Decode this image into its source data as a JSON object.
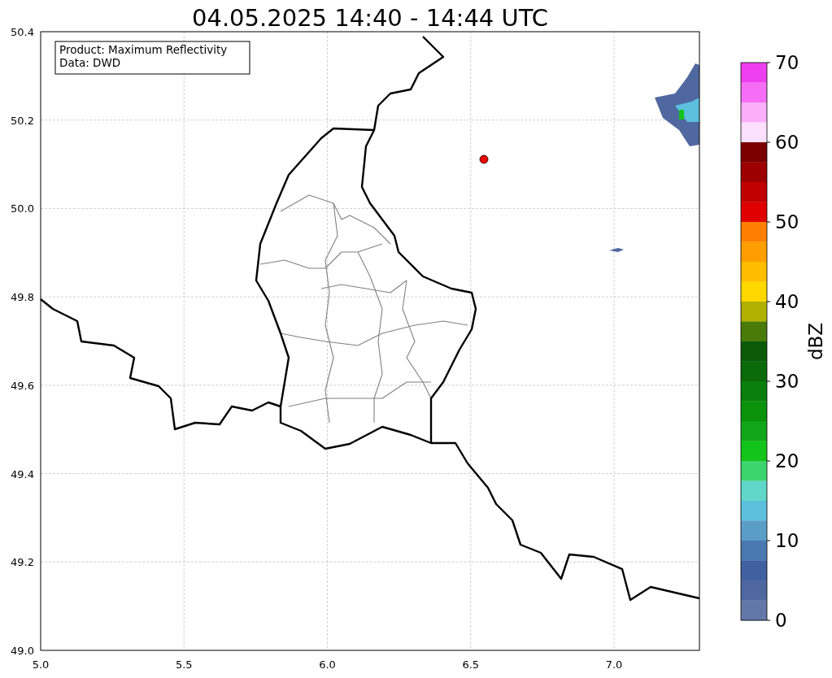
{
  "title": "04.05.2025 14:40 - 14:44 UTC",
  "info_box": [
    "Product: Maximum Reflectivity",
    "Data: DWD"
  ],
  "y_ticks": [
    "50.4",
    "50.2",
    "50.0",
    "49.8",
    "49.6",
    "49.4",
    "49.2",
    "49.0"
  ],
  "x_ticks": [
    "5.0",
    "5.5",
    "6.0",
    "6.5",
    "7.0"
  ],
  "colorbar": {
    "label": "dBZ",
    "ticks": [
      "70",
      "60",
      "50",
      "40",
      "30",
      "20",
      "10",
      "0"
    ],
    "segments": [
      {
        "color": "#ee3fee"
      },
      {
        "color": "#f56ef5"
      },
      {
        "color": "#fbaffb"
      },
      {
        "color": "#fde0fd"
      },
      {
        "color": "#7a0000"
      },
      {
        "color": "#9c0000"
      },
      {
        "color": "#c00000"
      },
      {
        "color": "#e00000"
      },
      {
        "color": "#ff7f00"
      },
      {
        "color": "#ff9e00"
      },
      {
        "color": "#ffbd00"
      },
      {
        "color": "#ffd800"
      },
      {
        "color": "#b0b000"
      },
      {
        "color": "#4a7a0a"
      },
      {
        "color": "#0a5a0a"
      },
      {
        "color": "#0a6a0a"
      },
      {
        "color": "#0a7e0a"
      },
      {
        "color": "#0b920b"
      },
      {
        "color": "#10a61a"
      },
      {
        "color": "#13c41a"
      },
      {
        "color": "#3cd46c"
      },
      {
        "color": "#60d6c8"
      },
      {
        "color": "#5cbfdc"
      },
      {
        "color": "#5a9ec8"
      },
      {
        "color": "#4a78b0"
      },
      {
        "color": "#4060a0"
      },
      {
        "color": "#5068a0"
      },
      {
        "color": "#6478a8"
      }
    ]
  }
}
